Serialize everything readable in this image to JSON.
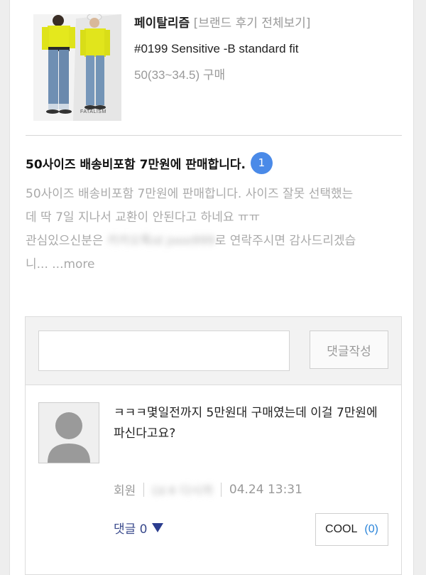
{
  "product": {
    "brand_name": "페이탈리즘",
    "brand_link": "[브랜드 후기 전체보기]",
    "product_name": "#0199 Sensitive -B standard fit",
    "purchase_info": "50(33~34.5) 구매",
    "thumbnail_logo": "FATALISM"
  },
  "post": {
    "title": "50사이즈 배송비포함 7만원에 판매합니다.",
    "comment_count_badge": "1",
    "body_line1": "50사이즈 배송비포함 7만원에 판매합니다. 사이즈 잘못 선택했는",
    "body_line2": "데 딱 7일 지나서 교환이 안된다고 하네요 ㅠㅠ",
    "body_line3_prefix": "관심있으신분은",
    "body_line3_blurred": "카카오톡id jooo999",
    "body_line3_suffix": "로 연락주시면 감사드리겠습",
    "body_line4": "니... ...more"
  },
  "comments": {
    "input_placeholder": "",
    "submit_label": "댓글작성",
    "items": [
      {
        "text": "ㅋㅋㅋ몇일전까지 5만원대 구매였는데 이걸 7만원에 파신다고요?",
        "author": "회원",
        "level_blurred": "LV.4 다시까",
        "time": "04.24 13:31",
        "reply_label": "댓글 0",
        "cool_label": "COOL",
        "cool_count": "(0)"
      }
    ]
  },
  "colors": {
    "badge": "#4a8ae8",
    "reply_link": "#3a4a8c",
    "cool_count": "#2a84d9",
    "muted_text": "#999999"
  }
}
